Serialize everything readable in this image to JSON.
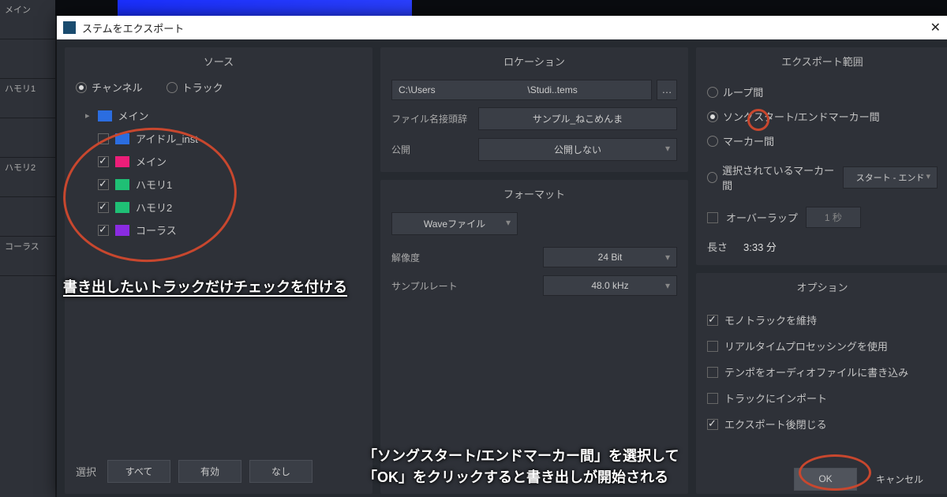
{
  "window": {
    "title": "ステムをエクスポート"
  },
  "bg_tracks": [
    "メイン",
    "ハモリ1",
    "ハモリ2",
    "コーラス"
  ],
  "source": {
    "title": "ソース",
    "radio_channel": "チャンネル",
    "radio_track": "トラック",
    "selected_mode": "channel",
    "tracks": [
      {
        "name": "メイン",
        "color": "blue",
        "checked": false,
        "is_parent": true
      },
      {
        "name": "アイドル_inst",
        "color": "blue",
        "checked": false
      },
      {
        "name": "メイン",
        "color": "pink",
        "checked": true
      },
      {
        "name": "ハモリ1",
        "color": "green",
        "checked": true
      },
      {
        "name": "ハモリ2",
        "color": "green",
        "checked": true
      },
      {
        "name": "コーラス",
        "color": "purple",
        "checked": true
      }
    ],
    "select_label": "選択",
    "btn_all": "すべて",
    "btn_enabled": "有効",
    "btn_none": "なし"
  },
  "location": {
    "title": "ロケーション",
    "path_prefix": "C:\\Users",
    "path_suffix": "\\Studi..tems",
    "prefix_label": "ファイル名接頭辞",
    "prefix_value": "サンプル_ねこめんま",
    "publish_label": "公開",
    "publish_value": "公開しない"
  },
  "format": {
    "title": "フォーマット",
    "filetype": "Waveファイル",
    "res_label": "解像度",
    "res_value": "24 Bit",
    "sr_label": "サンプルレート",
    "sr_value": "48.0 kHz"
  },
  "range": {
    "title": "エクスポート範囲",
    "opt_loop": "ループ間",
    "opt_song": "ソングスタート/エンドマーカー間",
    "opt_marker": "マーカー間",
    "opt_selmarker": "選択されているマーカー間",
    "selmarker_value": "スタート - エンド",
    "selected": "song",
    "overlap_label": "オーバーラップ",
    "overlap_value": "1 秒",
    "length_label": "長さ",
    "length_value": "3:33 分"
  },
  "options": {
    "title": "オプション",
    "opt_mono": {
      "label": "モノトラックを維持",
      "checked": true
    },
    "opt_rt": {
      "label": "リアルタイムプロセッシングを使用",
      "checked": false
    },
    "opt_tempo": {
      "label": "テンポをオーディオファイルに書き込み",
      "checked": false
    },
    "opt_import": {
      "label": "トラックにインポート",
      "checked": false
    },
    "opt_close": {
      "label": "エクスポート後閉じる",
      "checked": true
    }
  },
  "footer": {
    "ok": "OK",
    "cancel": "キャンセル"
  },
  "annotations": {
    "a1": "書き出したいトラックだけチェックを付ける",
    "a2_line1": "「ソングスタート/エンドマーカー間」を選択して",
    "a2_line2": "「OK」をクリックすると書き出しが開始される"
  }
}
